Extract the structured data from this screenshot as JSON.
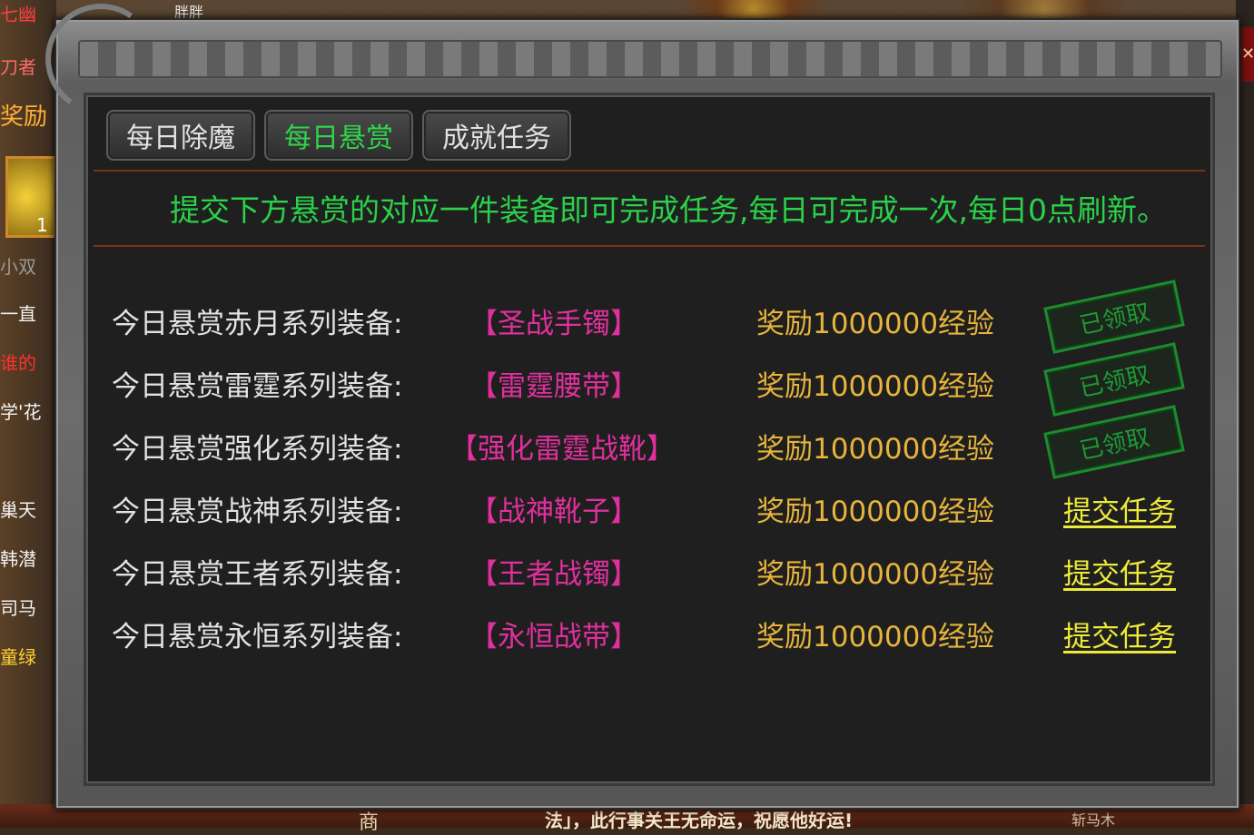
{
  "background": {
    "top_name": "胖胖",
    "left_labels": [
      "七幽",
      "刀者",
      "奖励",
      "1",
      "小双",
      "一直",
      "谁的",
      "学'花",
      "巢天",
      "韩潜",
      "司马",
      "童绿"
    ],
    "bottom_marquee": "法」，此行事关王无命运，祝愿他好运!",
    "bottom_shop": "商",
    "bottom_npc": "斩马木"
  },
  "dialog": {
    "tabs": [
      {
        "label": "每日除魔",
        "active": false
      },
      {
        "label": "每日悬赏",
        "active": true
      },
      {
        "label": "成就任务",
        "active": false
      }
    ],
    "notice": "提交下方悬赏的对应一件装备即可完成任务,每日可完成一次,每日0点刷新。",
    "rows": [
      {
        "label": "今日悬赏赤月系列装备:",
        "equipment": "【圣战手镯】",
        "reward": "奖励1000000经验",
        "status": "claimed",
        "action": "已领取"
      },
      {
        "label": "今日悬赏雷霆系列装备:",
        "equipment": "【雷霆腰带】",
        "reward": "奖励1000000经验",
        "status": "claimed",
        "action": "已领取"
      },
      {
        "label": "今日悬赏强化系列装备:",
        "equipment": "【强化雷霆战靴】",
        "reward": "奖励1000000经验",
        "status": "claimed",
        "action": "已领取"
      },
      {
        "label": "今日悬赏战神系列装备:",
        "equipment": "【战神靴子】",
        "reward": "奖励1000000经验",
        "status": "open",
        "action": "提交任务"
      },
      {
        "label": "今日悬赏王者系列装备:",
        "equipment": "【王者战镯】",
        "reward": "奖励1000000经验",
        "status": "open",
        "action": "提交任务"
      },
      {
        "label": "今日悬赏永恒系列装备:",
        "equipment": "【永恒战带】",
        "reward": "奖励1000000经验",
        "status": "open",
        "action": "提交任务"
      }
    ]
  },
  "colors": {
    "notice_green": "#2bd14a",
    "equipment_magenta": "#e0309e",
    "reward_gold": "#e7b43c",
    "submit_yellow": "#eeea3a",
    "stamp_green": "#1f9a35"
  }
}
